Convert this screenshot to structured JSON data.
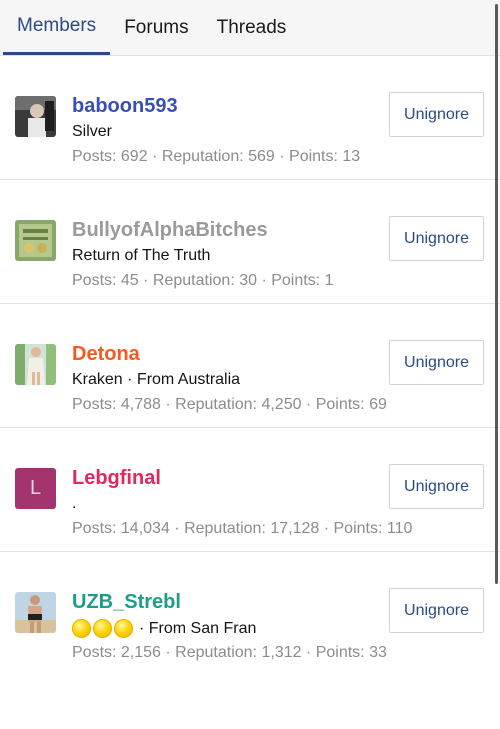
{
  "tabs": [
    {
      "label": "Members",
      "active": true
    },
    {
      "label": "Forums",
      "active": false
    },
    {
      "label": "Threads",
      "active": false
    }
  ],
  "members": [
    {
      "name": "baboon593",
      "name_color": "#3a4fb4",
      "title": "Silver",
      "badges": 0,
      "stats": "Posts: 692 · Reputation: 569 · Points: 13",
      "button": "Unignore",
      "avatar": "photo-dark"
    },
    {
      "name": "BullyofAlphaBitches",
      "name_color": "#9a9a9a",
      "title": "Return of The Truth",
      "badges": 0,
      "stats": "Posts: 45 · Reputation: 30 · Points: 1",
      "button": "Unignore",
      "avatar": "photo-green"
    },
    {
      "name": "Detona",
      "name_color": "#f25c1f",
      "title": "Kraken · From Australia",
      "badges": 0,
      "stats": "Posts: 4,788 · Reputation: 4,250 · Points: 69",
      "button": "Unignore",
      "avatar": "photo-person"
    },
    {
      "name": "Lebgfinal",
      "name_color": "#e0285e",
      "title": ".",
      "badges": 0,
      "stats": "Posts: 14,034 · Reputation: 17,128 · Points: 110",
      "button": "Unignore",
      "avatar_letter": "L"
    },
    {
      "name": "UZB_Strebl",
      "name_color": "#1e9e86",
      "title": "· From San Fran",
      "badges": 3,
      "stats": "Posts: 2,156 · Reputation: 1,312 · Points: 33",
      "button": "Unignore",
      "avatar": "photo-beach"
    }
  ]
}
